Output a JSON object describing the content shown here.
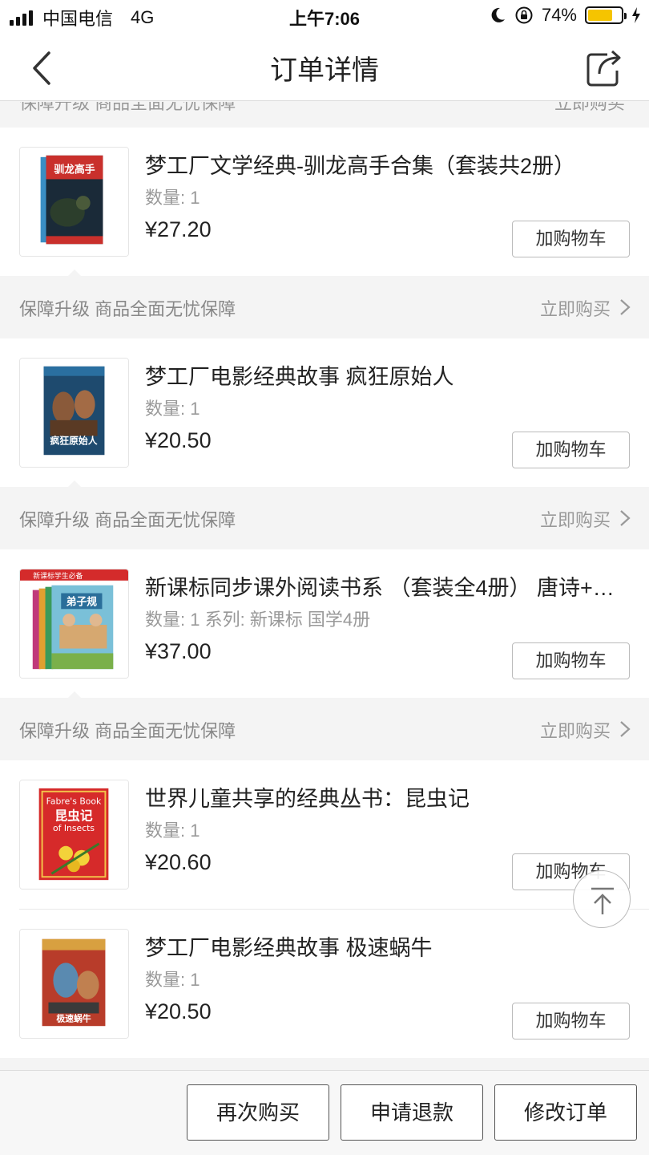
{
  "status_bar": {
    "carrier": "中国电信",
    "network": "4G",
    "time": "上午7:06",
    "battery": "74%",
    "battery_level": 0.74,
    "battery_color": "#f5c400"
  },
  "nav": {
    "title": "订单详情",
    "back_icon": "chevron-left-icon",
    "share_icon": "share-icon"
  },
  "products": [
    {
      "title": "梦工厂文学经典-驯龙高手合集（套装共2册）",
      "meta": "数量: 1",
      "price": "¥27.20",
      "cart_label": "加购物车",
      "cover_text": "驯龙高手"
    },
    {
      "title": "梦工厂电影经典故事 疯狂原始人",
      "meta": "数量: 1",
      "price": "¥20.50",
      "cart_label": "加购物车",
      "cover_text": "疯狂原始人"
    },
    {
      "title": "新课标同步课外阅读书系 （套装全4册） 唐诗+…",
      "meta": "数量: 1 系列: 新课标 国学4册",
      "price": "¥37.00",
      "cart_label": "加购物车",
      "cover_text": "弟子规",
      "cover_banner": "新课标学生必备"
    },
    {
      "title": "世界儿童共享的经典丛书：昆虫记",
      "meta": "数量: 1",
      "price": "¥20.60",
      "cart_label": "加购物车",
      "cover_text": "昆虫记",
      "cover_en1": "Fabre's Book",
      "cover_en2": "of Insects"
    },
    {
      "title": "梦工厂电影经典故事 极速蜗牛",
      "meta": "数量: 1",
      "price": "¥20.50",
      "cart_label": "加购物车",
      "cover_text": "极速蜗牛"
    }
  ],
  "guarantee": {
    "text": "保障升级 商品全面无忧保障",
    "link": "立即购买"
  },
  "bottom_bar": {
    "buy_again": "再次购买",
    "refund": "申请退款",
    "modify": "修改订单"
  },
  "colors": {
    "background": "#f4f4f4",
    "text": "#222222",
    "muted": "#999999"
  }
}
